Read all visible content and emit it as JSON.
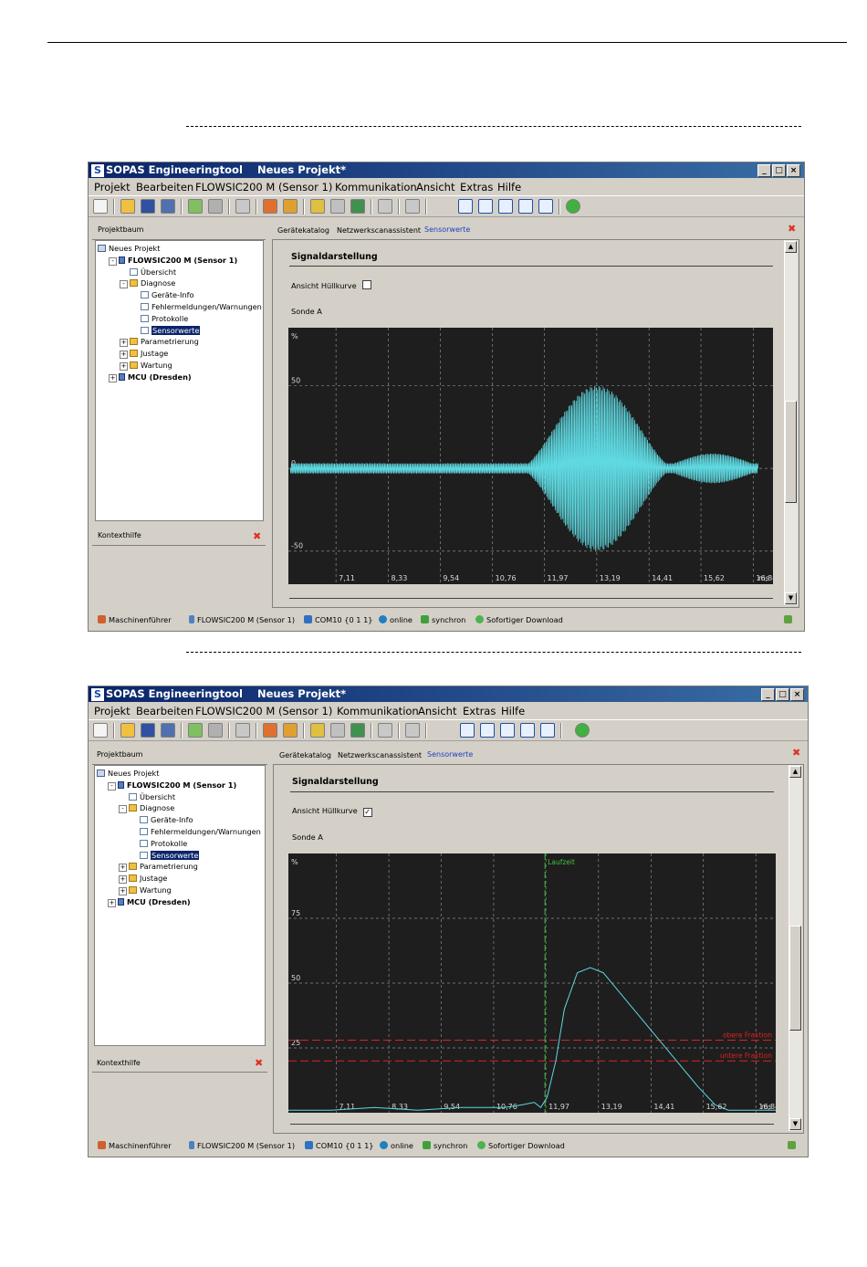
{
  "window": {
    "app_title": "SOPAS Engineeringtool",
    "project_title": "Neues Projekt*",
    "buttons": {
      "minimize": "_",
      "maximize": "□",
      "close": "×"
    }
  },
  "menu": [
    "Projekt",
    "Bearbeiten",
    "FLOWSIC200 M (Sensor 1)",
    "Kommunikation",
    "Ansicht",
    "Extras",
    "Hilfe"
  ],
  "left_panel": {
    "tab": "Projektbaum",
    "tree": [
      {
        "label": "Neues Projekt",
        "level": 0,
        "icon": "project-icon"
      },
      {
        "label": "FLOWSIC200 M (Sensor 1)",
        "level": 1,
        "icon": "device-icon",
        "bold": true,
        "expander": "-"
      },
      {
        "label": "Übersicht",
        "level": 2,
        "icon": "document-icon"
      },
      {
        "label": "Diagnose",
        "level": 2,
        "icon": "folder-icon",
        "expander": "-"
      },
      {
        "label": "Geräte-Info",
        "level": 3,
        "icon": "document-icon"
      },
      {
        "label": "Fehlermeldungen/Warnungen",
        "level": 3,
        "icon": "document-icon"
      },
      {
        "label": "Protokolle",
        "level": 3,
        "icon": "document-icon"
      },
      {
        "label": "Sensorwerte",
        "level": 3,
        "icon": "document-icon",
        "selected": true
      },
      {
        "label": "Parametrierung",
        "level": 2,
        "icon": "folder-icon",
        "expander": "+"
      },
      {
        "label": "Justage",
        "level": 2,
        "icon": "folder-icon",
        "expander": "+"
      },
      {
        "label": "Wartung",
        "level": 2,
        "icon": "folder-icon",
        "expander": "+"
      },
      {
        "label": "MCU (Dresden)",
        "level": 1,
        "icon": "device-icon",
        "bold": true,
        "expander": "+"
      }
    ],
    "help_tab": "Kontexthilfe"
  },
  "right_tabs": [
    "Gerätekatalog",
    "Netzwerkscanassistent",
    "Sensorwerte"
  ],
  "status_bar": [
    "Maschinenführer",
    "FLOWSIC200 M (Sensor 1)",
    "COM10 {0 1 1}",
    "online",
    "synchron",
    "Sofortiger Download"
  ],
  "screen1": {
    "section_title": "Signaldarstellung",
    "envelope_label": "Ansicht Hüllkurve",
    "envelope_checked": "",
    "probe_label": "Sonde A",
    "chart_data": {
      "type": "line",
      "title": "",
      "ylabel": "%",
      "xlabel": "ms",
      "ylim": [
        -70,
        85
      ],
      "y_ticks": [
        "50",
        "0",
        "-50"
      ],
      "y_tick_values": [
        50,
        0,
        -50
      ],
      "x_ticks": [
        "7,11",
        "8,33",
        "9,54",
        "10,76",
        "11,97",
        "13,19",
        "14,41",
        "15,62",
        "16,84"
      ],
      "x_tick_values": [
        7.11,
        8.33,
        9.54,
        10.76,
        11.97,
        13.19,
        14.41,
        15.62,
        16.84
      ],
      "xlim": [
        6.0,
        17.3
      ],
      "series": [
        {
          "type": "burst",
          "noise_amplitude": 3,
          "peak_amplitude": 50,
          "burst_center": 13.2,
          "burst_start": 11.4,
          "burst_end": 15.0,
          "cycles_per_ms": 30,
          "tail_start": 15.0,
          "tail_end": 16.8,
          "tail_amplitude": 6
        }
      ]
    }
  },
  "screen2": {
    "section_title": "Signaldarstellung",
    "envelope_label": "Ansicht Hüllkurve",
    "envelope_checked": "✓",
    "probe_label": "Sonde A",
    "chart_data": {
      "type": "line",
      "title": "",
      "ylabel": "%",
      "xlabel": "ms",
      "ylim": [
        0,
        100
      ],
      "y_ticks": [
        "75",
        "50",
        "25"
      ],
      "y_tick_values": [
        75,
        50,
        25
      ],
      "x_ticks": [
        "7,11",
        "8,33",
        "9,54",
        "10,76",
        "11,97",
        "13,19",
        "14,41",
        "15,62",
        "16,84"
      ],
      "x_tick_values": [
        7.11,
        8.33,
        9.54,
        10.76,
        11.97,
        13.19,
        14.41,
        15.62,
        16.84
      ],
      "xlim": [
        6.0,
        17.3
      ],
      "laufzeit_label": "Laufzeit",
      "laufzeit_x": 11.95,
      "thresholds": [
        {
          "name": "obere Fraktion",
          "value": 28
        },
        {
          "name": "untere Fraktion",
          "value": 20
        }
      ],
      "series": [
        {
          "name": "",
          "x": [
            6.0,
            7.0,
            8.0,
            9.0,
            10.0,
            11.0,
            11.4,
            11.7,
            11.85,
            12.0,
            12.2,
            12.4,
            12.7,
            13.0,
            13.3,
            13.6,
            14.0,
            14.5,
            15.0,
            15.5,
            15.9,
            16.2,
            16.5,
            16.8,
            17.3
          ],
          "y": [
            1,
            1,
            2,
            1,
            2,
            2,
            3,
            4,
            2,
            6,
            20,
            40,
            54,
            56,
            54,
            48,
            40,
            30,
            20,
            10,
            3,
            1,
            1,
            1,
            1
          ]
        }
      ]
    }
  }
}
